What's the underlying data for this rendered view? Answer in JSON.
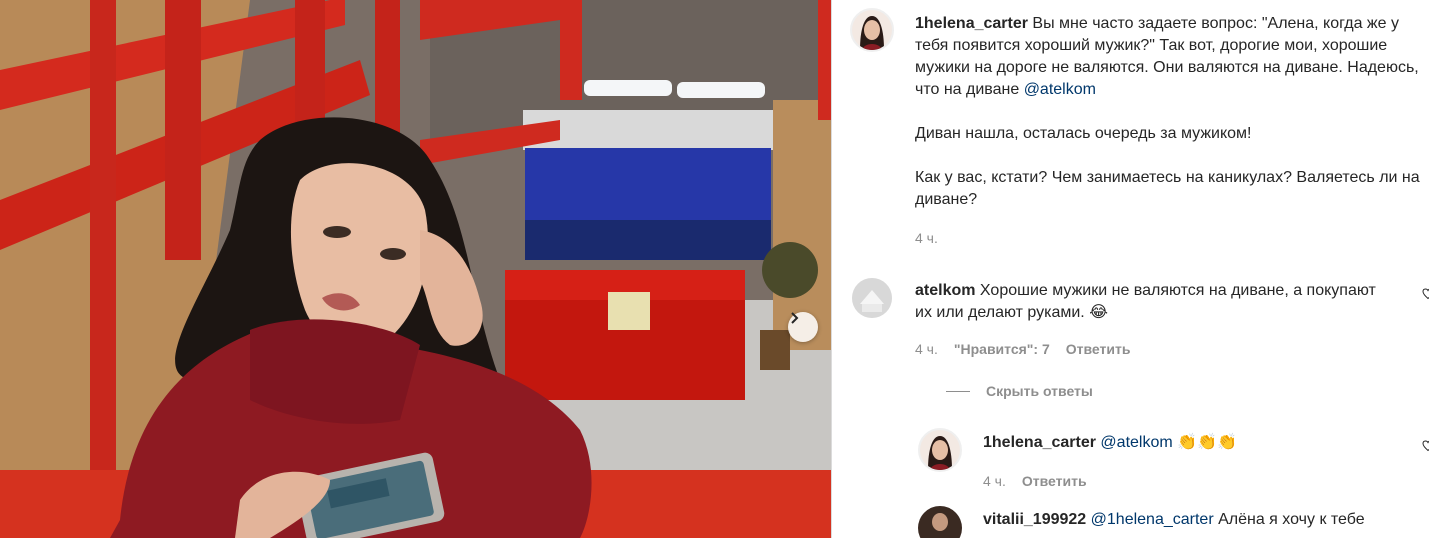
{
  "post_image": {
    "description_icon": "photo-of-woman-in-red-sweater"
  },
  "carousel": {
    "next_icon": "chevron-right-icon"
  },
  "comments": {
    "caption": {
      "username": "1helena_carter",
      "text_line1": "Вы мне часто задаете вопрос: \"Алена, когда же у тебя появится хороший мужик?\" Так вот, дорогие мои, хорошие мужики на дороге не валяются. Они валяются на диване. Надеюсь, что на диване",
      "mention": "@atelkom",
      "text_para2": "Диван нашла, осталась очередь за мужиком!",
      "text_para3": "Как у вас, кстати? Чем занимаетесь на каникулах? Валяетесь ли на диване?",
      "time": "4 ч."
    },
    "comment1": {
      "username": "atelkom",
      "text": "Хорошие мужики не валяются на диване, а покупают их или делают руками.",
      "emoji": "😂",
      "time": "4 ч.",
      "likes": "\"Нравится\": 7",
      "reply_label": "Ответить"
    },
    "hide_replies_label": "Скрыть ответы",
    "reply1": {
      "username": "1helena_carter",
      "mention": "@atelkom",
      "emojis": "👏👏👏",
      "time": "4 ч.",
      "reply_label": "Ответить"
    },
    "reply2": {
      "username": "vitalii_199922",
      "mention": "@1helena_carter",
      "text": "Алёна я хочу к тебе"
    }
  },
  "colors": {
    "mention": "#00376b",
    "meta_gray": "#8e8e8e",
    "sweater_red": "#8e1a22",
    "railing_red": "#d42a1e"
  }
}
